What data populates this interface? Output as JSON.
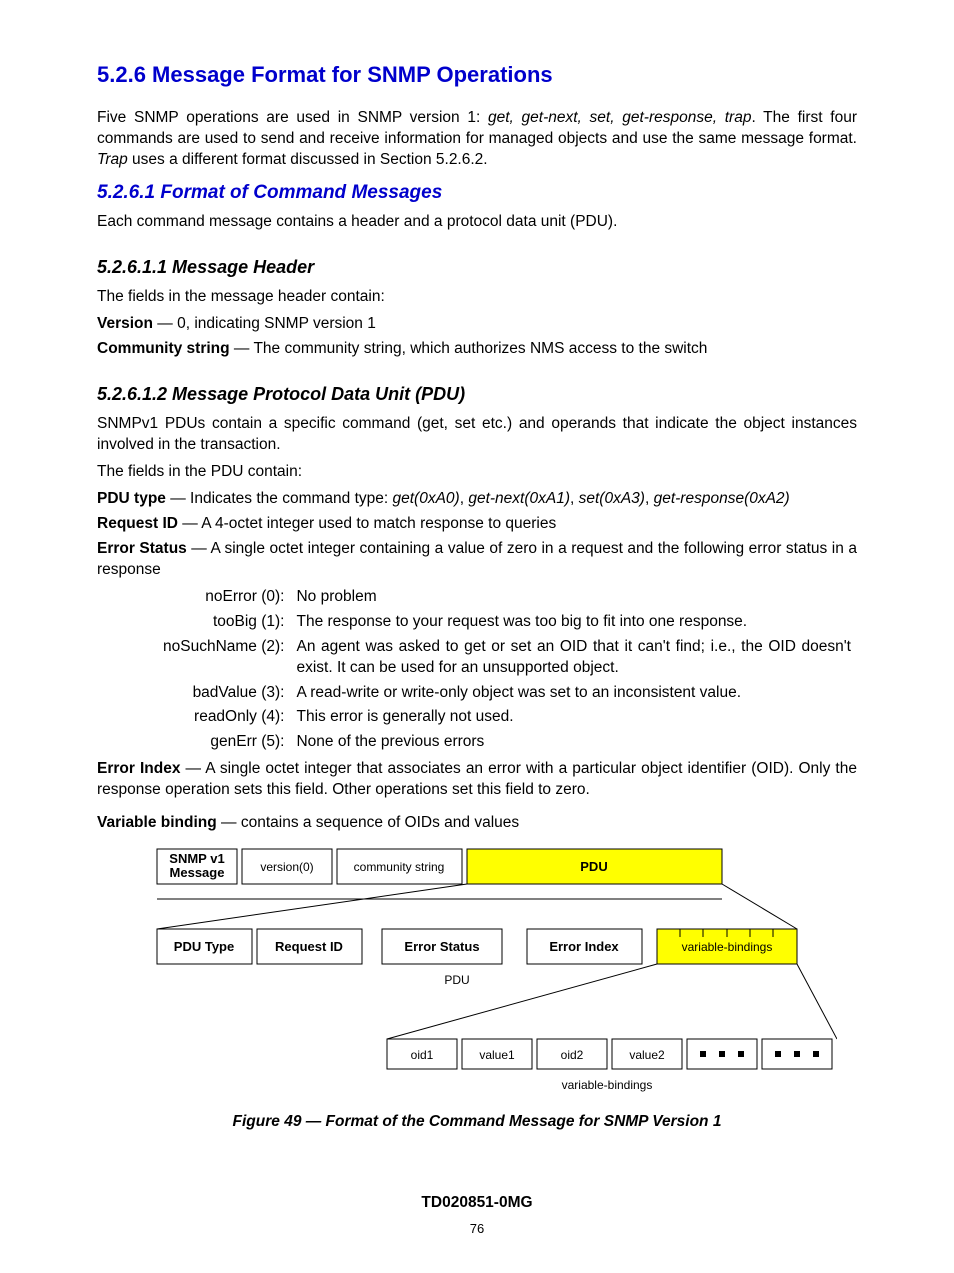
{
  "h526": "5.2.6   Message Format for SNMP Operations",
  "p1a": "Five SNMP operations are used in SNMP version 1:  ",
  "p1b": "get, get-next, set, get-response, trap",
  "p1c": ".  The first four commands are used to send and receive information for managed objects and use the same message format.  ",
  "p1d": "Trap",
  "p1e": " uses a different format discussed in Section 5.2.6.2.",
  "h5261": "5.2.6.1   Format of Command Messages",
  "p2": "Each command message contains a header and a protocol data unit (PDU).",
  "h52611": "5.2.6.1.1   Message Header",
  "p3": "The fields in the message header contain:",
  "f_version_lbl": "Version",
  "f_version_txt": " — 0, indicating  SNMP version 1",
  "f_comm_lbl": "Community string",
  "f_comm_txt": " — The community string, which authorizes NMS access to the switch",
  "h52612": "5.2.6.1.2   Message Protocol Data Unit (PDU)",
  "p4": "SNMPv1 PDUs contain a specific command (get, set etc.) and operands that indicate the object instances involved in the transaction.",
  "p5": "  The fields in the PDU contain:",
  "f_pdu_lbl": "PDU type",
  "f_pdu_txta": " — Indicates the command type:  ",
  "f_pdu_txtb": "get(0xA0)",
  "f_pdu_txtc": ", ",
  "f_pdu_txtd": "get-next(0xA1)",
  "f_pdu_txte": ", ",
  "f_pdu_txtf": "set(0xA3)",
  "f_pdu_txtg": ", ",
  "f_pdu_txth": "get-response(0xA2)",
  "f_req_lbl": "Request ID",
  "f_req_txt": " — A 4-octet integer used to match response to queries",
  "f_err_lbl": "Error Status",
  "f_err_txt": " — A single octet integer containing a value of zero in a request and the following error status in a response",
  "errs": {
    "r0k": "noError (0):",
    "r0v": "No problem",
    "r1k": "tooBig (1):",
    "r1v": "The response to your request was too big to fit into one response.",
    "r2k": "noSuchName (2):",
    "r2v": "An agent was asked to get or set an OID that it can't find; i.e., the OID doesn't exist.  It can be used for an unsupported object.",
    "r3k": "badValue (3):",
    "r3v": "A read-write or write-only object was set to an inconsistent value.",
    "r4k": "readOnly (4):",
    "r4v": "This error is generally not used.",
    "r5k": "genErr (5):",
    "r5v": "None of the previous errors"
  },
  "f_eidx_lbl": "Error Index",
  "f_eidx_txt": " — A single octet integer that associates an error with a particular object identifier (OID).  Only the response operation sets this field.  Other operations set this field to zero.",
  "f_vb_lbl": " Variable binding",
  "f_vb_txt": " — contains a sequence of OIDs and values",
  "diagram": {
    "row1": {
      "snmp": "SNMP v1\nMessage",
      "version": "version(0)",
      "comm": "community string",
      "pdu": "PDU"
    },
    "row2": {
      "pdutype": "PDU Type",
      "reqid": "Request ID",
      "errstat": "Error Status",
      "erridx": "Error Index",
      "vb": "variable-bindings",
      "label": "PDU"
    },
    "row3": {
      "oid1": "oid1",
      "val1": "value1",
      "oid2": "oid2",
      "val2": "value2",
      "label": "variable-bindings"
    }
  },
  "figcap": "Figure 49 — Format of the Command Message for SNMP Version 1",
  "docnum": "TD020851-0MG",
  "pagenum": "76"
}
